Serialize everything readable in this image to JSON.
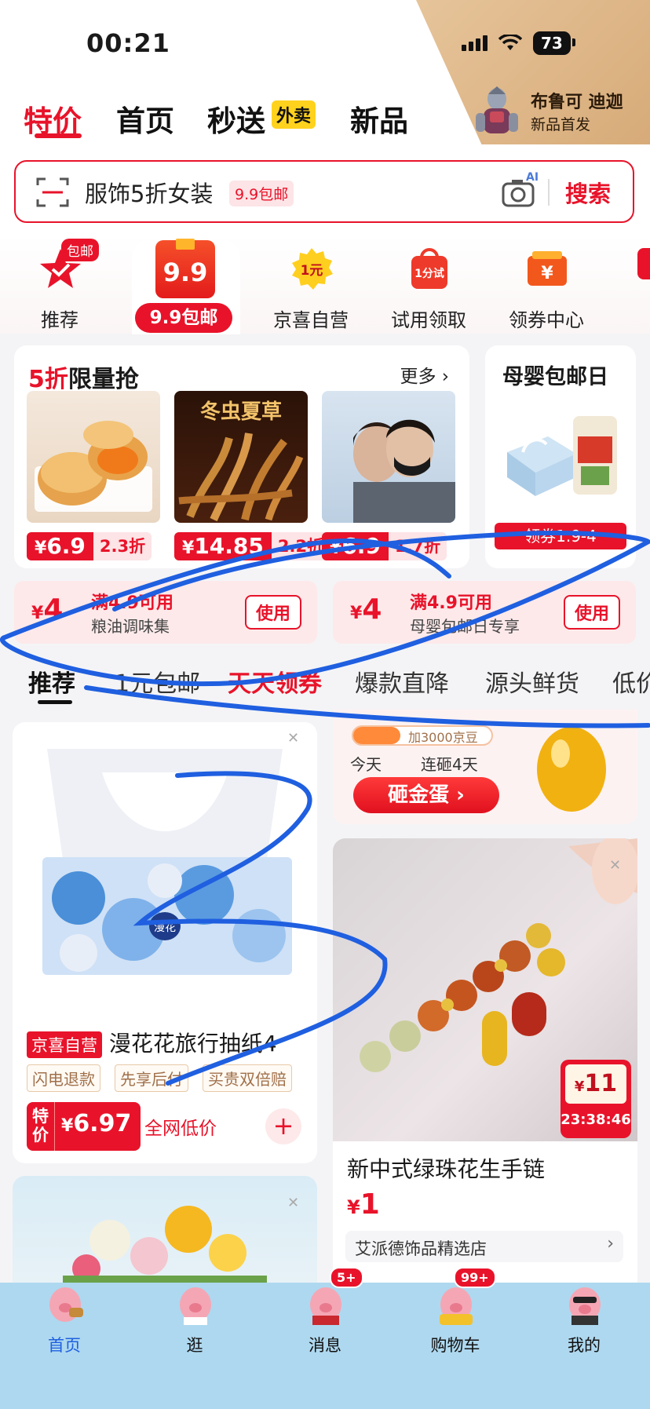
{
  "status": {
    "time": "00:21",
    "battery": "73"
  },
  "promo": {
    "line1": "布鲁可 迪迦",
    "line2": "新品首发"
  },
  "nav_tabs": [
    {
      "label": "特价"
    },
    {
      "label": "首页"
    },
    {
      "label": "秒送"
    },
    {
      "label": "新品"
    }
  ],
  "waimai_badge": "外卖",
  "search": {
    "text": "服饰5折女装",
    "tag": "9.9包邮",
    "ai_label": "AI",
    "button": "搜索"
  },
  "categories": [
    {
      "label": "推荐",
      "badge": "包邮",
      "icon": "star-check-icon"
    },
    {
      "label": "9.9包邮",
      "icon_text": "9.9",
      "icon": "nine-nine-icon"
    },
    {
      "label": "京喜自营",
      "icon_text": "1元",
      "icon": "one-yuan-icon"
    },
    {
      "label": "试用领取",
      "icon_text": "1分试",
      "icon": "trial-bag-icon"
    },
    {
      "label": "领券中心",
      "icon_text": "¥",
      "icon": "coupon-icon"
    }
  ],
  "flash_sale": {
    "title_red": "5折",
    "title_black": "限量抢",
    "more": "更多",
    "products": [
      {
        "price": "6.9",
        "discount": "2.3折",
        "image": "mooncake-image"
      },
      {
        "price": "14.85",
        "discount": "2.2折",
        "image": "cordyceps-image",
        "image_text": "冬虫夏草"
      },
      {
        "price": "6.9",
        "discount": "1.7折",
        "image": "face-mask-image"
      }
    ]
  },
  "baby_day": {
    "title": "母婴包邮日",
    "coupon": "领券1.9-4"
  },
  "coupons": [
    {
      "amount": "4",
      "condition": "满4.9可用",
      "desc": "粮油调味集",
      "button": "使用"
    },
    {
      "amount": "4",
      "condition": "满4.9可用",
      "desc": "母婴包邮日专享",
      "button": "使用"
    }
  ],
  "rec_tabs": [
    "推荐",
    "1元包邮",
    "天天领券",
    "爆款直降",
    "源头鲜货",
    "低价"
  ],
  "egg_card": {
    "progress": "加3000京豆",
    "day1": "今天",
    "day2": "连砸4天",
    "button": "砸金蛋 ›"
  },
  "product_left": {
    "tag": "京喜自营",
    "title": "漫花花旅行抽纸4",
    "features": [
      "闪电退款",
      "先享后付",
      "买贵双倍赔"
    ],
    "price_label": "特价",
    "price": "6.97",
    "price_note": "全网低价",
    "brand_text": "漫花"
  },
  "product_right": {
    "title": "新中式绿珠花生手链",
    "price": "1",
    "flash_price": "11",
    "countdown": "23:38:46",
    "store": "艾派德饰品精选店"
  },
  "bottom_nav": [
    {
      "label": "首页",
      "badge": ""
    },
    {
      "label": "逛",
      "badge": ""
    },
    {
      "label": "消息",
      "badge": "5+"
    },
    {
      "label": "购物车",
      "badge": "99+"
    },
    {
      "label": "我的",
      "badge": ""
    }
  ],
  "colors": {
    "accent": "#e8132a",
    "nav_bg": "#aed8ef",
    "scribble": "#1f5fe0"
  }
}
